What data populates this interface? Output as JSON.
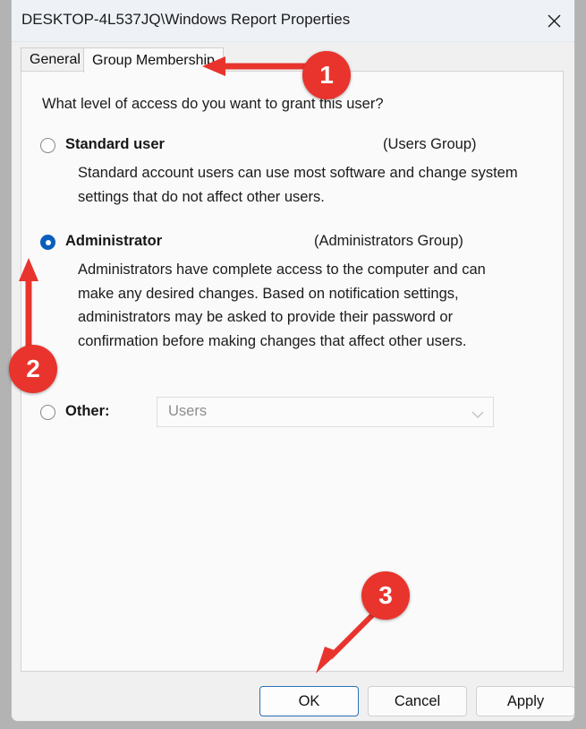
{
  "window": {
    "title": "DESKTOP-4L537JQ\\Windows Report Properties",
    "close_icon": "close-icon"
  },
  "tabs": [
    {
      "label": "General",
      "active": false
    },
    {
      "label": "Group Membership",
      "active": true
    }
  ],
  "content": {
    "question": "What level of access do you want to grant this user?",
    "options": [
      {
        "id": "standard",
        "label": "Standard user",
        "group": "(Users Group)",
        "description": "Standard account users can use most software and change system settings that do not affect other users.",
        "selected": false
      },
      {
        "id": "administrator",
        "label": "Administrator",
        "group": "(Administrators Group)",
        "description": "Administrators have complete access to the computer and can make any desired changes. Based on notification settings, administrators may be asked to provide their password or confirmation before making changes that affect other users.",
        "selected": true
      },
      {
        "id": "other",
        "label": "Other:",
        "combo_value": "Users",
        "combo_chevron": "chevron-down-icon",
        "selected": false
      }
    ]
  },
  "footer": {
    "ok_label": "OK",
    "cancel_label": "Cancel",
    "apply_label": "Apply"
  },
  "annotations": {
    "marker_1": "1",
    "marker_2": "2",
    "marker_3": "3",
    "color": "#e8342c"
  }
}
